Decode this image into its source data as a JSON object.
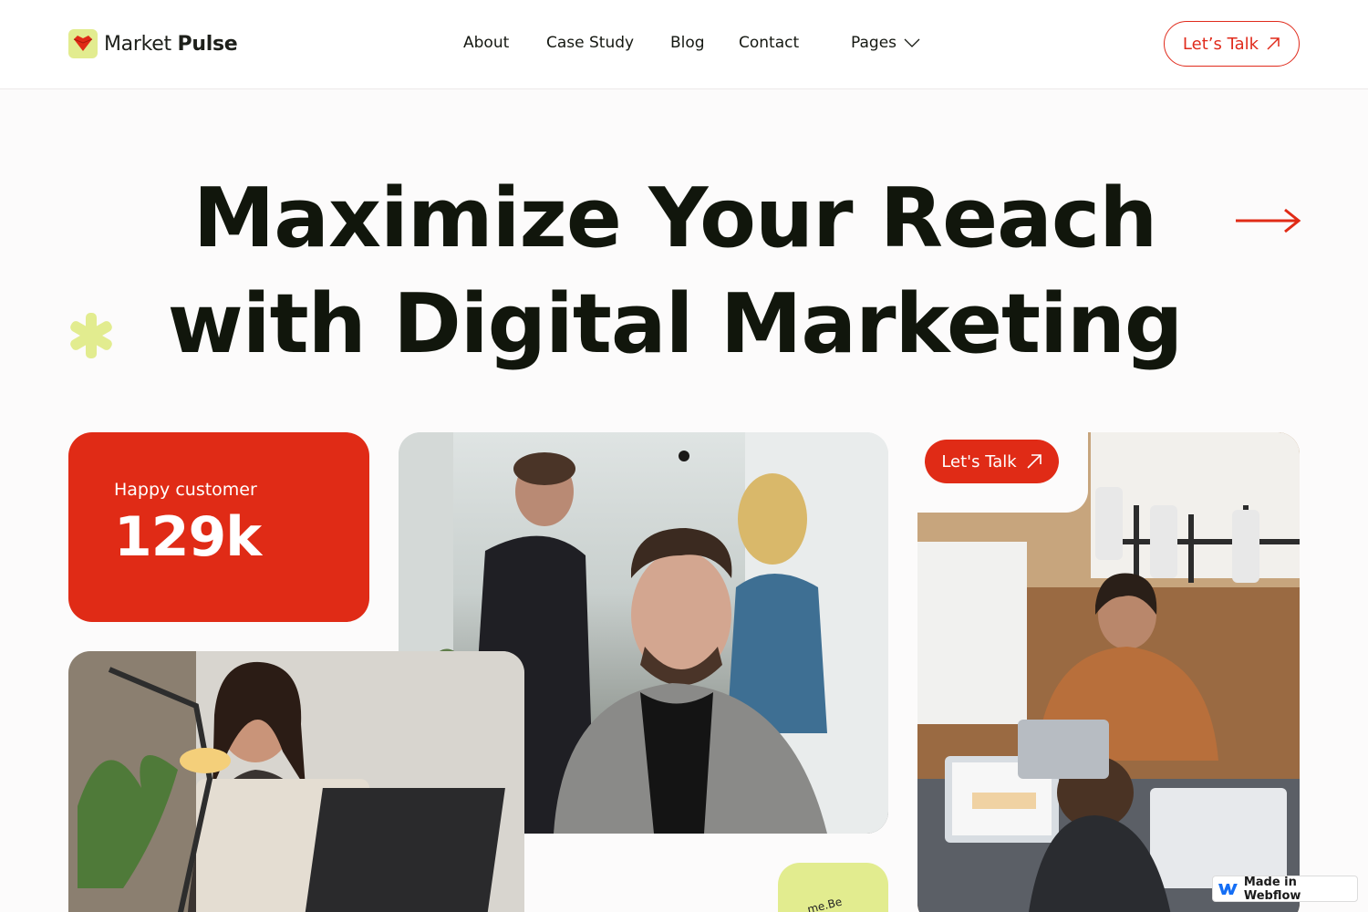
{
  "brand": {
    "name_light": "Market",
    "name_bold": "Pulse",
    "accent": "#e02b16",
    "lime": "#e2ec8f"
  },
  "nav": {
    "items": [
      {
        "label": "About"
      },
      {
        "label": "Case Study"
      },
      {
        "label": "Blog"
      },
      {
        "label": "Contact"
      },
      {
        "label": "Pages",
        "icon": "chevron-down-icon"
      }
    ],
    "cta_label": "Let’s Talk"
  },
  "hero": {
    "title_line1": "Maximize Your Reach",
    "title_line2": "with Digital Marketing"
  },
  "stat": {
    "label": "Happy customer",
    "value": "129k"
  },
  "cards": {
    "cta_label": "Let's Talk",
    "badge_text": "me.Be"
  },
  "footer_badge": {
    "label": "Made in Webflow"
  }
}
